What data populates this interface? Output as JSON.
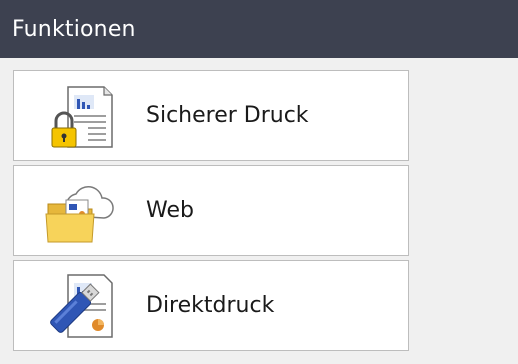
{
  "header": {
    "title": "Funktionen"
  },
  "items": [
    {
      "label": "Sicherer Druck",
      "icon": "secure-print-icon"
    },
    {
      "label": "Web",
      "icon": "web-folder-cloud-icon"
    },
    {
      "label": "Direktdruck",
      "icon": "usb-direct-print-icon"
    }
  ],
  "colors": {
    "header_bg": "#3d4150",
    "background": "#f0f0f0",
    "item_bg": "#ffffff",
    "item_border": "#bdbdbd",
    "lock_yellow": "#f5c400",
    "folder_yellow": "#f7d35a",
    "usb_blue": "#2f56b5"
  }
}
